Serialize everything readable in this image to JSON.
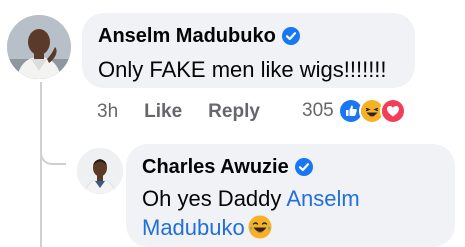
{
  "comment": {
    "author": "Anselm Madubuko",
    "verified_icon": "verified-badge-icon",
    "text": "Only FAKE men like wigs!!!!!!!",
    "time": "3h",
    "like_label": "Like",
    "reply_label": "Reply",
    "reaction_count": "305",
    "reactions": [
      "like-reaction-icon",
      "haha-reaction-icon",
      "love-reaction-icon"
    ]
  },
  "reply": {
    "author": "Charles Awuzie",
    "verified_icon": "verified-badge-icon",
    "text_prefix": "Oh yes Daddy",
    "mention": "Anselm Madubuko",
    "emoji": "laughing-emoji-icon"
  },
  "colors": {
    "bubble": "#f0f2f5",
    "mention": "#216fdb",
    "meta": "#65676b",
    "verified": "#1877f2"
  }
}
